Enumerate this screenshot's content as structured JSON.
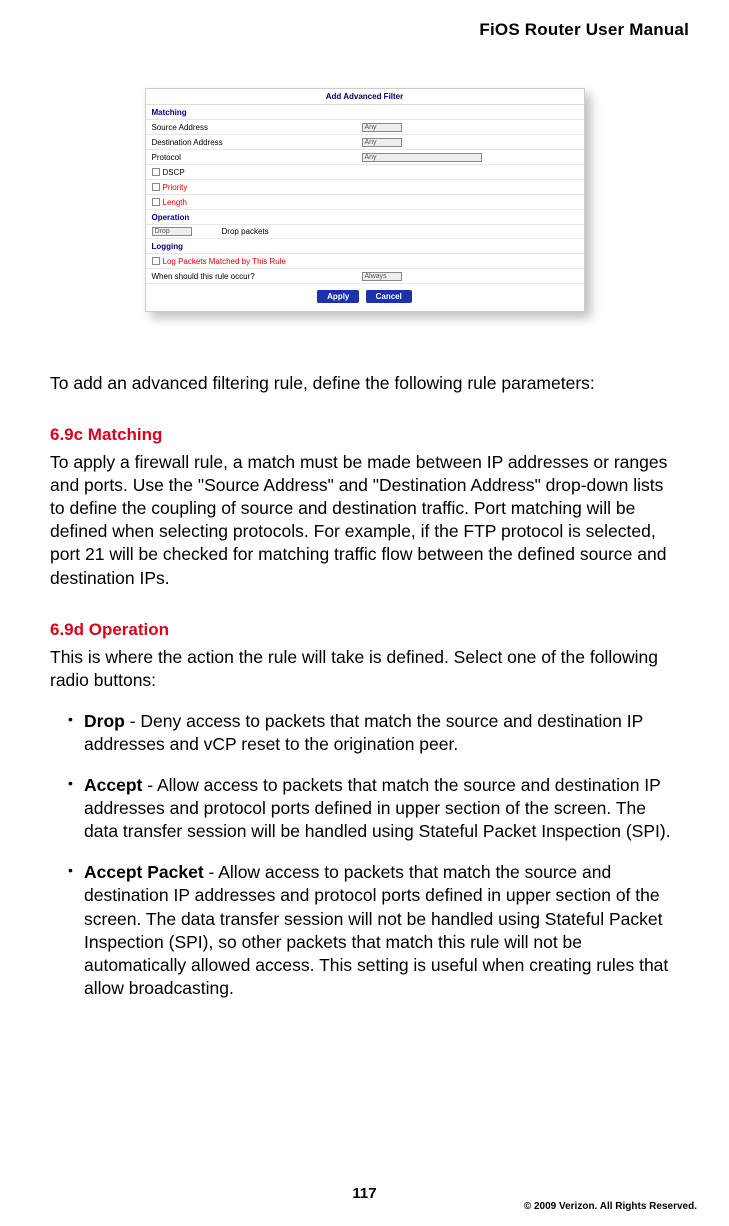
{
  "header": {
    "title": "FiOS Router User Manual"
  },
  "screenshot": {
    "title": "Add Advanced Filter",
    "rows": {
      "matching": "Matching",
      "source_address": "Source Address",
      "destination_address": "Destination Address",
      "protocol": "Protocol",
      "dscp": "DSCP",
      "priority": "Priority",
      "length": "Length",
      "operation": "Operation",
      "drop_packets": "Drop packets",
      "logging": "Logging",
      "log_packets": "Log Packets Matched by This Rule",
      "when": "When should this rule occur?"
    },
    "selects": {
      "any": "Any",
      "drop": "Drop",
      "always": "Always"
    },
    "buttons": {
      "apply": "Apply",
      "cancel": "Cancel"
    }
  },
  "intro": "To add an advanced filtering rule, define the following rule parameters:",
  "sec_matching": {
    "heading": "6.9c  Matching",
    "body": "To apply a firewall rule, a match must be made between IP addresses or ranges and ports. Use the \"Source Address\" and \"Destination Address\" drop-down lists to define the coupling of source and destination traffic. Port matching will be defined when selecting protocols. For example, if the FTP protocol is selected, port 21 will be checked for matching traffic flow between the defined source and destination IPs."
  },
  "sec_operation": {
    "heading": "6.9d  Operation",
    "body": "This is where the action the rule will take is defined. Select one of the following radio buttons:",
    "items": [
      {
        "term": "Drop",
        "rest": " - Deny access to packets that match the source and destination IP addresses and vCP reset to the origination peer."
      },
      {
        "term": "Accept",
        "rest": " - Allow access to packets that match the source and destination IP addresses and protocol ports defined in upper section of the screen. The data transfer session will be handled using Stateful Packet Inspection (SPI)."
      },
      {
        "term": "Accept Packet",
        "rest": " - Allow access to packets that match the source and destination IP addresses and protocol ports defined in upper section of the screen. The data transfer session will not be handled using Stateful Packet Inspection (SPI), so other packets that match this rule will not be automatically allowed access. This setting is useful when creating rules that allow broadcasting."
      }
    ]
  },
  "footer": {
    "page": "117",
    "copyright": "© 2009 Verizon. All Rights Reserved."
  }
}
